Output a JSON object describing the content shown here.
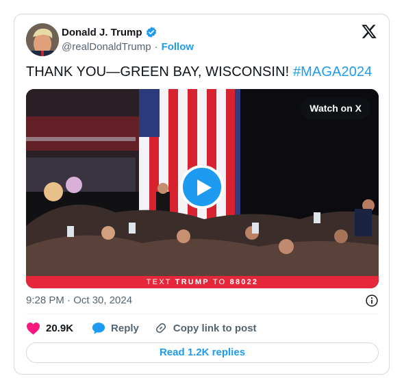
{
  "author": {
    "name": "Donald J. Trump",
    "handle": "@realDonaldTrump",
    "separator": "·",
    "follow_label": "Follow"
  },
  "tweet": {
    "text": "THANK YOU—GREEN BAY, WISCONSIN! ",
    "hashtag": "#MAGA2024"
  },
  "media": {
    "watch_label": "Watch on X",
    "banner_text_1": "TEXT ",
    "banner_keyword": "TRUMP",
    "banner_text_2": " TO ",
    "banner_number": "88022"
  },
  "timestamp": "9:28 PM · Oct 30, 2024",
  "actions": {
    "likes": "20.9K",
    "reply_label": "Reply",
    "copy_label": "Copy link to post"
  },
  "read_replies_label": "Read 1.2K replies",
  "icons": {
    "verified": "verified-badge-icon",
    "x_logo": "x-logo-icon",
    "info": "info-icon",
    "heart": "heart-icon",
    "reply": "reply-bubble-icon",
    "link": "link-icon",
    "play": "play-icon"
  },
  "colors": {
    "accent": "#1d9bf0",
    "heart": "#f91880",
    "banner": "#e5263b",
    "muted": "#536471"
  }
}
